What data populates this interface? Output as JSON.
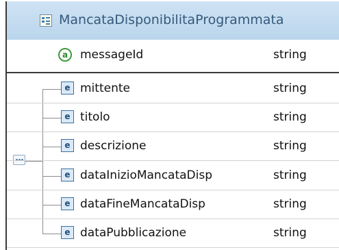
{
  "complex_type": {
    "name": "MancataDisponibilitaProgrammata",
    "icon": "complex-type-icon"
  },
  "attribute": {
    "badge": "a",
    "name": "messageId",
    "type": "string",
    "icon": "attribute-icon"
  },
  "sequence": {
    "icon": "sequence-compositor-icon",
    "elements": [
      {
        "badge": "e",
        "name": "mittente",
        "type": "string"
      },
      {
        "badge": "e",
        "name": "titolo",
        "type": "string"
      },
      {
        "badge": "e",
        "name": "descrizione",
        "type": "string"
      },
      {
        "badge": "e",
        "name": "dataInizioMancataDisp",
        "type": "string"
      },
      {
        "badge": "e",
        "name": "dataFineMancataDisp",
        "type": "string"
      },
      {
        "badge": "e",
        "name": "dataPubblicazione",
        "type": "string"
      }
    ]
  },
  "colors": {
    "header_bg": "#c3dbf0",
    "header_text": "#35587a",
    "attribute_icon": "#3f9a3f",
    "element_icon": "#3d6f9f",
    "frame_border": "#3a3a3a"
  }
}
